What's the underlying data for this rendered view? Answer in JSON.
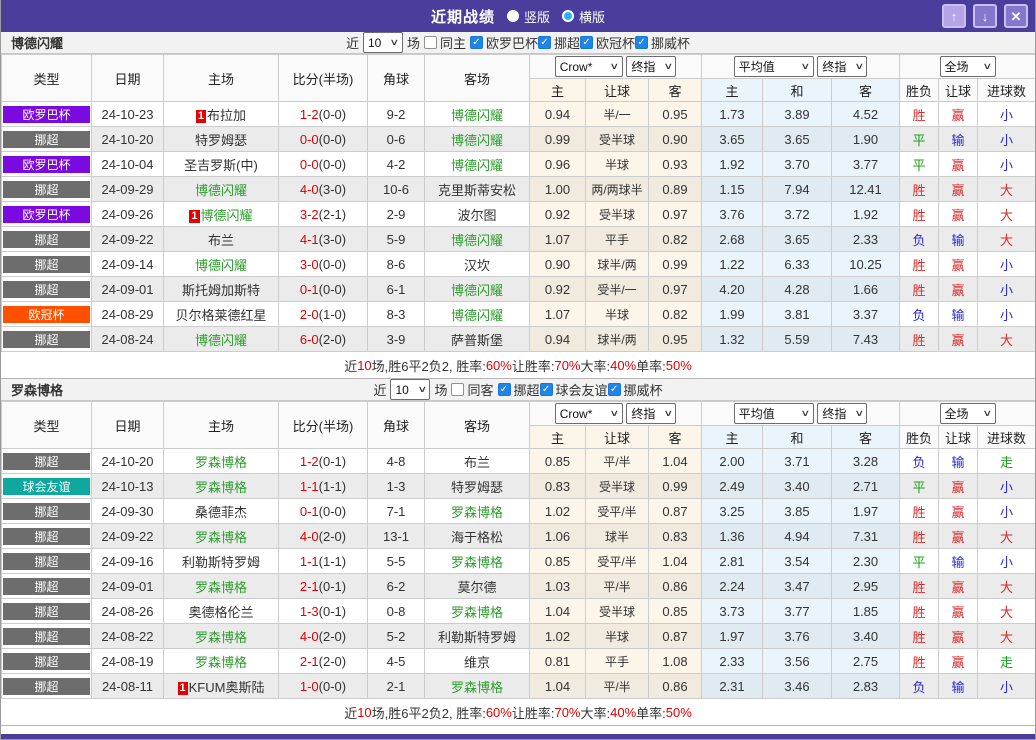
{
  "titlebar": {
    "title": "近期战绩",
    "radios": [
      {
        "label": "竖版",
        "selected": false
      },
      {
        "label": "横版",
        "selected": true
      }
    ],
    "icons": {
      "up": "↑",
      "down": "↓",
      "close": "✕"
    }
  },
  "icons": {
    "chevron": "∨",
    "check": "✓"
  },
  "filters": {
    "near": "近",
    "games": "场",
    "count": "10"
  },
  "table_header": {
    "type": "类型",
    "date": "日期",
    "home": "主场",
    "score": "比分(半场)",
    "corner": "角球",
    "away": "客场",
    "crown_select": "Crow*",
    "final_select": "终指",
    "avg_select": "平均值",
    "final_select2": "终指",
    "full_select": "全场",
    "sub": [
      "主",
      "让球",
      "客",
      "主",
      "和",
      "客",
      "胜负",
      "让球",
      "进球数"
    ]
  },
  "colors": {
    "league": {
      "欧罗巴杯": "#7a0ae0",
      "挪超": "#6d6d6d",
      "欧冠杯": "#fe5000",
      "球会友谊": "#0ea89e"
    },
    "result": {
      "胜": "#d92b2b",
      "平": "#18a018",
      "负": "#2929d8",
      "赢": "#d92b2b",
      "输": "#2929d8",
      "大": "#d92b2b",
      "小": "#2929d8",
      "走": "#18a018"
    },
    "team_name": "#2e9e2e",
    "accent": "#4b3d9c"
  },
  "sections": [
    {
      "team": "博德闪耀",
      "same_filter": {
        "label": "同主",
        "checked": false
      },
      "leagues": [
        {
          "label": "欧罗巴杯",
          "checked": true
        },
        {
          "label": "挪超",
          "checked": true
        },
        {
          "label": "欧冠杯",
          "checked": true
        },
        {
          "label": "挪威杯",
          "checked": true
        }
      ],
      "rows": [
        {
          "league": "欧罗巴杯",
          "date": "24-10-23",
          "home": "布拉加",
          "home_red": "1",
          "home_is_team": false,
          "score": "1-2",
          "half": "(0-0)",
          "corners": "9-2",
          "away": "博德闪耀",
          "away_is_team": true,
          "crown": [
            "0.94",
            "半/一",
            "0.95"
          ],
          "avg": [
            "1.73",
            "3.89",
            "4.52"
          ],
          "results": [
            "胜",
            "赢",
            "小"
          ]
        },
        {
          "league": "挪超",
          "date": "24-10-20",
          "home": "特罗姆瑟",
          "home_is_team": false,
          "score": "0-0",
          "half": "(0-0)",
          "corners": "0-6",
          "away": "博德闪耀",
          "away_is_team": true,
          "crown": [
            "0.99",
            "受半球",
            "0.90"
          ],
          "avg": [
            "3.65",
            "3.65",
            "1.90"
          ],
          "results": [
            "平",
            "输",
            "小"
          ]
        },
        {
          "league": "欧罗巴杯",
          "date": "24-10-04",
          "home": "圣吉罗斯(中)",
          "home_is_team": false,
          "score": "0-0",
          "half": "(0-0)",
          "corners": "4-2",
          "away": "博德闪耀",
          "away_is_team": true,
          "crown": [
            "0.96",
            "半球",
            "0.93"
          ],
          "avg": [
            "1.92",
            "3.70",
            "3.77"
          ],
          "results": [
            "平",
            "赢",
            "小"
          ]
        },
        {
          "league": "挪超",
          "date": "24-09-29",
          "home": "博德闪耀",
          "home_is_team": true,
          "score": "4-0",
          "half": "(3-0)",
          "corners": "10-6",
          "away": "克里斯蒂安松",
          "away_is_team": false,
          "crown": [
            "1.00",
            "两/两球半",
            "0.89"
          ],
          "avg": [
            "1.15",
            "7.94",
            "12.41"
          ],
          "results": [
            "胜",
            "赢",
            "大"
          ]
        },
        {
          "league": "欧罗巴杯",
          "date": "24-09-26",
          "home": "博德闪耀",
          "home_red": "1",
          "home_is_team": true,
          "score": "3-2",
          "half": "(2-1)",
          "corners": "2-9",
          "away": "波尔图",
          "away_is_team": false,
          "crown": [
            "0.92",
            "受半球",
            "0.97"
          ],
          "avg": [
            "3.76",
            "3.72",
            "1.92"
          ],
          "results": [
            "胜",
            "赢",
            "大"
          ]
        },
        {
          "league": "挪超",
          "date": "24-09-22",
          "home": "布兰",
          "home_is_team": false,
          "score": "4-1",
          "half": "(3-0)",
          "corners": "5-9",
          "away": "博德闪耀",
          "away_is_team": true,
          "crown": [
            "1.07",
            "平手",
            "0.82"
          ],
          "avg": [
            "2.68",
            "3.65",
            "2.33"
          ],
          "results": [
            "负",
            "输",
            "大"
          ]
        },
        {
          "league": "挪超",
          "date": "24-09-14",
          "home": "博德闪耀",
          "home_is_team": true,
          "score": "3-0",
          "half": "(0-0)",
          "corners": "8-6",
          "away": "汉坎",
          "away_is_team": false,
          "crown": [
            "0.90",
            "球半/两",
            "0.99"
          ],
          "avg": [
            "1.22",
            "6.33",
            "10.25"
          ],
          "results": [
            "胜",
            "赢",
            "小"
          ]
        },
        {
          "league": "挪超",
          "date": "24-09-01",
          "home": "斯托姆加斯特",
          "home_is_team": false,
          "score": "0-1",
          "half": "(0-0)",
          "corners": "6-1",
          "away": "博德闪耀",
          "away_is_team": true,
          "crown": [
            "0.92",
            "受半/一",
            "0.97"
          ],
          "avg": [
            "4.20",
            "4.28",
            "1.66"
          ],
          "results": [
            "胜",
            "赢",
            "小"
          ]
        },
        {
          "league": "欧冠杯",
          "date": "24-08-29",
          "home": "贝尔格莱德红星",
          "home_is_team": false,
          "score": "2-0",
          "half": "(1-0)",
          "corners": "8-3",
          "away": "博德闪耀",
          "away_is_team": true,
          "crown": [
            "1.07",
            "半球",
            "0.82"
          ],
          "avg": [
            "1.99",
            "3.81",
            "3.37"
          ],
          "results": [
            "负",
            "输",
            "小"
          ]
        },
        {
          "league": "挪超",
          "date": "24-08-24",
          "home": "博德闪耀",
          "home_is_team": true,
          "score": "6-0",
          "half": "(2-0)",
          "corners": "3-9",
          "away": "萨普斯堡",
          "away_is_team": false,
          "crown": [
            "0.94",
            "球半/两",
            "0.95"
          ],
          "avg": [
            "1.32",
            "5.59",
            "7.43"
          ],
          "results": [
            "胜",
            "赢",
            "大"
          ]
        }
      ],
      "summary": [
        {
          "text": "近"
        },
        {
          "text": "10",
          "red": true
        },
        {
          "text": "场,胜6平2负2, 胜率:"
        },
        {
          "text": "60%",
          "red": true
        },
        {
          "text": " 让胜率:"
        },
        {
          "text": "70%",
          "red": true
        },
        {
          "text": " 大率:"
        },
        {
          "text": "40%",
          "red": true
        },
        {
          "text": " 单率:"
        },
        {
          "text": "50%",
          "red": true
        }
      ]
    },
    {
      "team": "罗森博格",
      "same_filter": {
        "label": "同客",
        "checked": false
      },
      "leagues": [
        {
          "label": "挪超",
          "checked": true
        },
        {
          "label": "球会友谊",
          "checked": true
        },
        {
          "label": "挪威杯",
          "checked": true
        }
      ],
      "rows": [
        {
          "league": "挪超",
          "date": "24-10-20",
          "home": "罗森博格",
          "home_is_team": true,
          "score": "1-2",
          "half": "(0-1)",
          "corners": "4-8",
          "away": "布兰",
          "away_is_team": false,
          "crown": [
            "0.85",
            "平/半",
            "1.04"
          ],
          "avg": [
            "2.00",
            "3.71",
            "3.28"
          ],
          "results": [
            "负",
            "输",
            "走"
          ]
        },
        {
          "league": "球会友谊",
          "date": "24-10-13",
          "home": "罗森博格",
          "home_is_team": true,
          "score": "1-1",
          "half": "(1-1)",
          "corners": "1-3",
          "away": "特罗姆瑟",
          "away_is_team": false,
          "crown": [
            "0.83",
            "受半球",
            "0.99"
          ],
          "avg": [
            "2.49",
            "3.40",
            "2.71"
          ],
          "results": [
            "平",
            "赢",
            "小"
          ]
        },
        {
          "league": "挪超",
          "date": "24-09-30",
          "home": "桑德菲杰",
          "home_is_team": false,
          "score": "0-1",
          "half": "(0-0)",
          "corners": "7-1",
          "away": "罗森博格",
          "away_is_team": true,
          "crown": [
            "1.02",
            "受平/半",
            "0.87"
          ],
          "avg": [
            "3.25",
            "3.85",
            "1.97"
          ],
          "results": [
            "胜",
            "赢",
            "小"
          ]
        },
        {
          "league": "挪超",
          "date": "24-09-22",
          "home": "罗森博格",
          "home_is_team": true,
          "score": "4-0",
          "half": "(2-0)",
          "corners": "13-1",
          "away": "海于格松",
          "away_is_team": false,
          "crown": [
            "1.06",
            "球半",
            "0.83"
          ],
          "avg": [
            "1.36",
            "4.94",
            "7.31"
          ],
          "results": [
            "胜",
            "赢",
            "大"
          ]
        },
        {
          "league": "挪超",
          "date": "24-09-16",
          "home": "利勒斯特罗姆",
          "home_is_team": false,
          "score": "1-1",
          "half": "(1-1)",
          "corners": "5-5",
          "away": "罗森博格",
          "away_is_team": true,
          "crown": [
            "0.85",
            "受平/半",
            "1.04"
          ],
          "avg": [
            "2.81",
            "3.54",
            "2.30"
          ],
          "results": [
            "平",
            "输",
            "小"
          ]
        },
        {
          "league": "挪超",
          "date": "24-09-01",
          "home": "罗森博格",
          "home_is_team": true,
          "score": "2-1",
          "half": "(0-1)",
          "corners": "6-2",
          "away": "莫尔德",
          "away_is_team": false,
          "crown": [
            "1.03",
            "平/半",
            "0.86"
          ],
          "avg": [
            "2.24",
            "3.47",
            "2.95"
          ],
          "results": [
            "胜",
            "赢",
            "大"
          ]
        },
        {
          "league": "挪超",
          "date": "24-08-26",
          "home": "奥德格伦兰",
          "home_is_team": false,
          "score": "1-3",
          "half": "(0-1)",
          "corners": "0-8",
          "away": "罗森博格",
          "away_is_team": true,
          "crown": [
            "1.04",
            "受半球",
            "0.85"
          ],
          "avg": [
            "3.73",
            "3.77",
            "1.85"
          ],
          "results": [
            "胜",
            "赢",
            "大"
          ]
        },
        {
          "league": "挪超",
          "date": "24-08-22",
          "home": "罗森博格",
          "home_is_team": true,
          "score": "4-0",
          "half": "(2-0)",
          "corners": "5-2",
          "away": "利勒斯特罗姆",
          "away_is_team": false,
          "crown": [
            "1.02",
            "半球",
            "0.87"
          ],
          "avg": [
            "1.97",
            "3.76",
            "3.40"
          ],
          "results": [
            "胜",
            "赢",
            "大"
          ]
        },
        {
          "league": "挪超",
          "date": "24-08-19",
          "home": "罗森博格",
          "home_is_team": true,
          "score": "2-1",
          "half": "(2-0)",
          "corners": "4-5",
          "away": "维京",
          "away_is_team": false,
          "crown": [
            "0.81",
            "平手",
            "1.08"
          ],
          "avg": [
            "2.33",
            "3.56",
            "2.75"
          ],
          "results": [
            "胜",
            "赢",
            "走"
          ]
        },
        {
          "league": "挪超",
          "date": "24-08-11",
          "home": "KFUM奥斯陆",
          "home_red": "1",
          "home_is_team": false,
          "score": "1-0",
          "half": "(0-0)",
          "corners": "2-1",
          "away": "罗森博格",
          "away_is_team": true,
          "crown": [
            "1.04",
            "平/半",
            "0.86"
          ],
          "avg": [
            "2.31",
            "3.46",
            "2.83"
          ],
          "results": [
            "负",
            "输",
            "小"
          ]
        }
      ],
      "summary": [
        {
          "text": "近"
        },
        {
          "text": "10",
          "red": true
        },
        {
          "text": "场,胜6平2负2, 胜率:"
        },
        {
          "text": "60%",
          "red": true
        },
        {
          "text": " 让胜率:"
        },
        {
          "text": "70%",
          "red": true
        },
        {
          "text": " 大率:"
        },
        {
          "text": "40%",
          "red": true
        },
        {
          "text": " 单率:"
        },
        {
          "text": "50%",
          "red": true
        }
      ]
    }
  ]
}
